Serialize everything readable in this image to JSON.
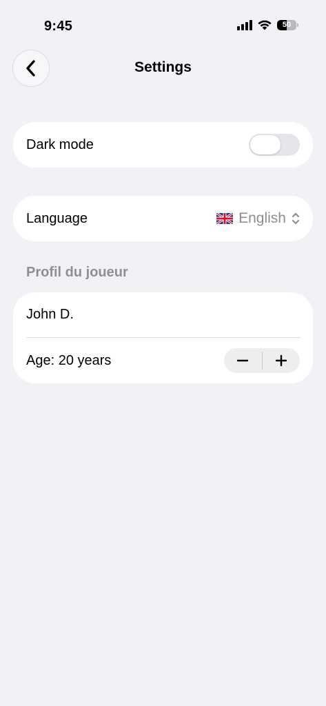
{
  "status_bar": {
    "time": "9:45",
    "battery_level": "50",
    "battery_fraction": 0.5,
    "icons": [
      "cellular-signal-icon",
      "wifi-icon",
      "battery-icon"
    ]
  },
  "nav": {
    "back_icon": "chevron-left-icon",
    "title": "Settings"
  },
  "dark_mode": {
    "label": "Dark mode",
    "enabled": false
  },
  "language": {
    "label": "Language",
    "flag_icon": "uk-flag-icon",
    "selected": "English",
    "chevron_icon": "chevron-up-down-icon"
  },
  "profile": {
    "section_title": "Profil du joueur",
    "name": "John D.",
    "age_label": "Age: 20 years",
    "age_value": 20,
    "decrement_icon": "minus-icon",
    "increment_icon": "plus-icon"
  },
  "colors": {
    "background": "#f2f1f6",
    "card": "#ffffff",
    "secondary_text": "#8e8e93",
    "toggle_off": "#e5e5ea"
  }
}
